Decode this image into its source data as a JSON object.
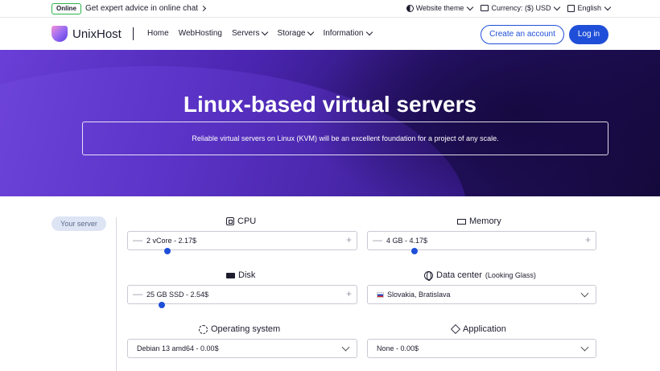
{
  "topbar": {
    "badge": "Online",
    "advice": "Get expert advice in online chat",
    "theme": "Website theme",
    "currency": "Currency: ($) USD",
    "language": "English"
  },
  "header": {
    "brand": "UnixHost",
    "nav": [
      "Home",
      "WebHosting",
      "Servers",
      "Storage",
      "Information"
    ],
    "create_account": "Create an account",
    "login": "Log in"
  },
  "hero": {
    "title": "Linux-based virtual servers",
    "subtitle": "Reliable virtual servers on Linux (KVM) will be an excellent foundation for a project of any scale."
  },
  "config": {
    "your_server": "Your server",
    "cpu": {
      "label": "CPU",
      "value": "2 vCore - 2.17$",
      "level": 0.12
    },
    "memory": {
      "label": "Memory",
      "value": "4 GB - 4.17$",
      "level": 0.2
    },
    "disk": {
      "label": "Disk",
      "value": "25 GB SSD - 2.54$",
      "level": 0.12
    },
    "datacenter": {
      "label": "Data center",
      "sub": "(Looking Glass)",
      "value": "Slovakia, Bratislava"
    },
    "os": {
      "label": "Operating system",
      "value": "Debian 13 amd64 - 0.00$"
    },
    "application": {
      "label": "Application",
      "value": "None - 0.00$"
    },
    "minus": "—",
    "plus": "+"
  }
}
